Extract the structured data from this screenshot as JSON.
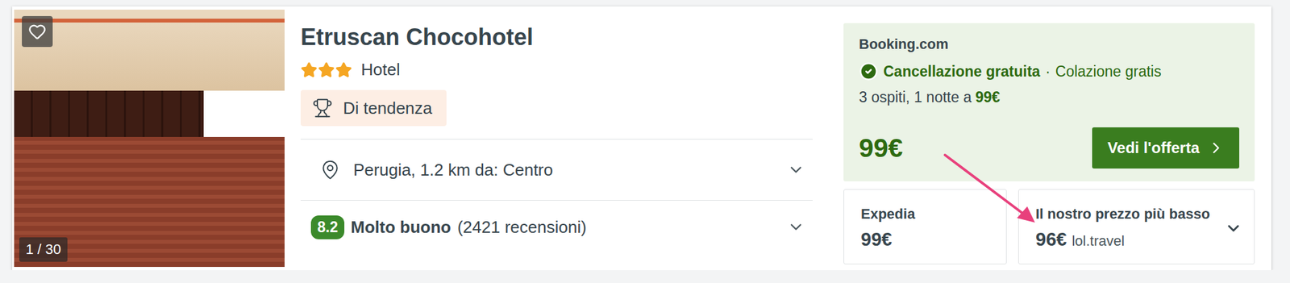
{
  "hotel": {
    "name": "Etruscan Chocohotel",
    "stars": 3,
    "type": "Hotel",
    "badge": "Di tendenza",
    "favorite": false,
    "photo_counter": "1 / 30"
  },
  "location": {
    "text": "Perugia, 1.2 km da: Centro",
    "expanded": false
  },
  "rating": {
    "score": "8.2",
    "label": "Molto buono",
    "reviews": "(2421 recensioni)",
    "expanded": false
  },
  "main_offer": {
    "provider": "Booking.com",
    "cancellation": "Cancellazione gratuita",
    "separator": "·",
    "breakfast": "Colazione gratis",
    "summary": "3 ospiti, 1 notte a",
    "summary_price": "99€",
    "price": "99€",
    "button": "Vedi l'offerta"
  },
  "other_offers": [
    {
      "title": "Expedia",
      "price": "99€",
      "provider": "",
      "kind": "plain"
    },
    {
      "title": "Il nostro prezzo più basso",
      "price": "96€",
      "provider": "lol.travel",
      "kind": "dropdown"
    }
  ]
}
